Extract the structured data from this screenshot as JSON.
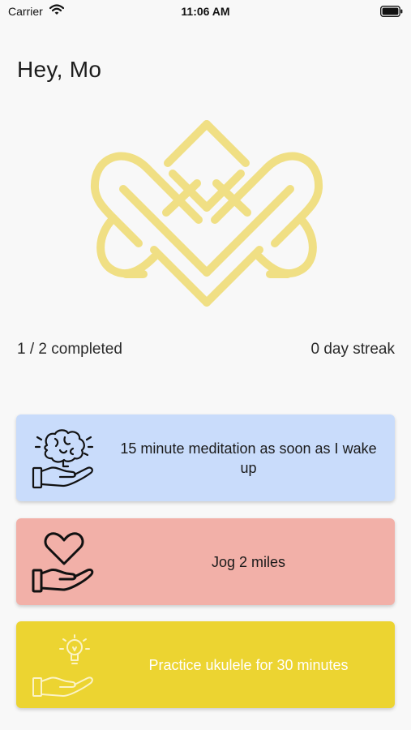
{
  "status_bar": {
    "carrier": "Carrier",
    "time": "11:06 AM",
    "wifi_icon": "wifi-icon",
    "battery_icon": "battery-icon"
  },
  "greeting": "Hey, Mo",
  "logo": {
    "icon": "celtic-knot-hearts-icon",
    "color": "#f0df84"
  },
  "stats": {
    "completed": "1 / 2 completed",
    "streak": "0 day streak"
  },
  "habits": [
    {
      "label": "15 minute meditation as soon as I wake up",
      "icon": "brain-in-hand-icon",
      "bg": "#c9dcfb",
      "text_color": "#1a1a1a"
    },
    {
      "label": "Jog 2 miles",
      "icon": "heart-in-hand-icon",
      "bg": "#f2b0a8",
      "text_color": "#1a1a1a"
    },
    {
      "label": "Practice ukulele for 30 minutes",
      "icon": "lightbulb-in-hand-icon",
      "bg": "#ecd431",
      "text_color": "#ffffff"
    }
  ]
}
